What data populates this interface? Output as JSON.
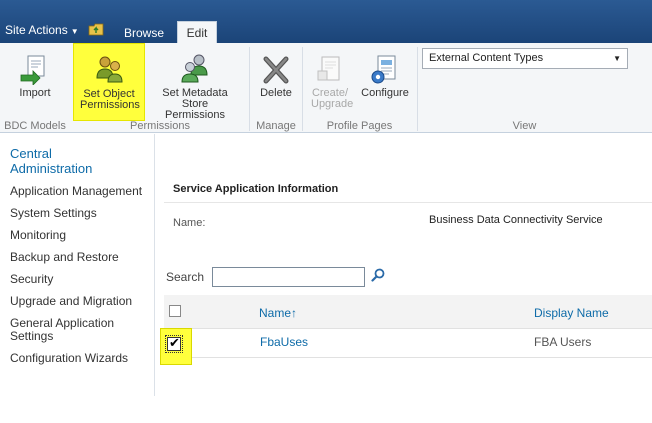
{
  "topbar": {
    "site_actions": "Site Actions",
    "tabs": [
      {
        "label": "Browse"
      },
      {
        "label": "Edit"
      }
    ]
  },
  "ribbon": {
    "buttons": {
      "import": "Import",
      "set_object_permissions": "Set Object Permissions",
      "set_metadata_store_permissions": "Set Metadata Store Permissions",
      "delete": "Delete",
      "create_upgrade": "Create/ Upgrade",
      "configure": "Configure"
    },
    "groups": {
      "bdc_models": "BDC Models",
      "permissions": "Permissions",
      "manage": "Manage",
      "profile_pages": "Profile Pages",
      "view": "View"
    },
    "view_select_value": "External Content Types"
  },
  "leftnav": {
    "heading": "Central Administration",
    "items": [
      {
        "label": "Application Management"
      },
      {
        "label": "System Settings"
      },
      {
        "label": "Monitoring"
      },
      {
        "label": "Backup and Restore"
      },
      {
        "label": "Security"
      },
      {
        "label": "Upgrade and Migration"
      },
      {
        "label": "General Application Settings"
      },
      {
        "label": "Configuration Wizards"
      }
    ]
  },
  "content": {
    "section_title": "Service Application Information",
    "name_label": "Name:",
    "name_value": "Business Data Connectivity Service",
    "search_label": "Search",
    "table": {
      "columns": {
        "name": "Name↑",
        "display_name": "Display Name"
      },
      "rows": [
        {
          "name": "FbaUses",
          "display_name": "FBA Users",
          "checked": true
        }
      ]
    }
  },
  "colors": {
    "topbar": "#1f4e86",
    "highlight": "#ffff3c",
    "link": "#0e6ba8"
  }
}
